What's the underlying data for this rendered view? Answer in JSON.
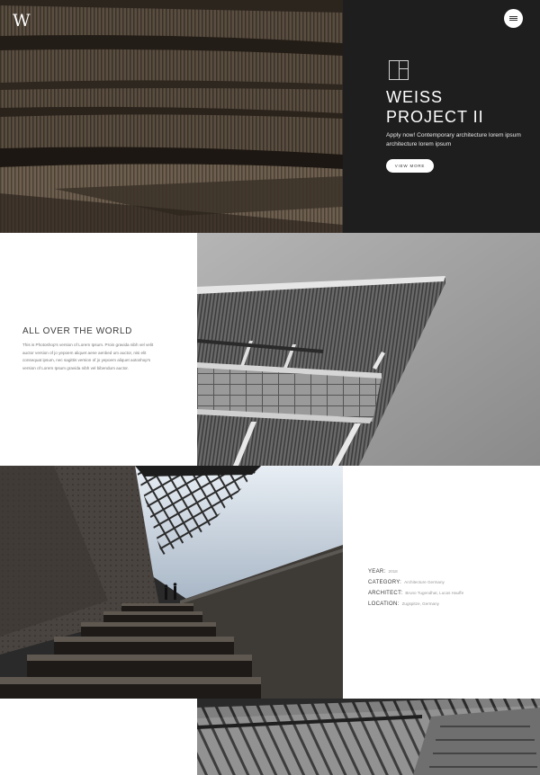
{
  "header": {
    "logo_text": "W",
    "menu_icon": "hamburger-icon"
  },
  "hero": {
    "image_desc_icon": "building-facade-image",
    "project_icon": "layout-icon",
    "title_line1": "WEISS",
    "title_line2": "PROJECT II",
    "description": "Apply now! Contemporary architecture lorem ipsum architecture lorem ipsum",
    "button_label": "VIEW MORE"
  },
  "about": {
    "title": "ALL OVER THE WORLD",
    "text": "This is Photoshop's version of Lorem Ipsum. Proin gravida nibh vel velit auctor version of jo yepoem aliquet aene aenbed um auctor, nisi elit consequat ipsum, nec sagittis version of jo yepoem aliquet aotoshop's version of Lorem Ipsum gravida nibh vel bibendum auctor."
  },
  "details": [
    {
      "label": "YEAR:",
      "value": "2018"
    },
    {
      "label": "CATEGORY:",
      "value": "Architecture Germany"
    },
    {
      "label": "ARCHITECT:",
      "value": "Bruno Tugendhat, Lucas Hauffe"
    },
    {
      "label": "LOCATION:",
      "value": "Zugspitze, Germany"
    }
  ],
  "colors": {
    "dark_panel": "#1f1e1e",
    "text_dark": "#3b3b3b",
    "text_muted": "#999999"
  }
}
